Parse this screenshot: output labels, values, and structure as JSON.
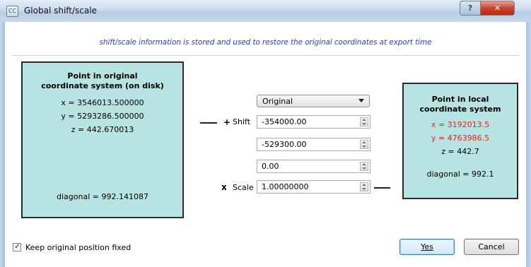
{
  "window": {
    "title": "Global shift/scale",
    "app_icon_text": "CC",
    "help_label": "?",
    "close_label": "✕"
  },
  "info_text": "shift/scale information is stored and used to restore the original coordinates at export time",
  "original_panel": {
    "title_line1": "Point in original",
    "title_line2": "coordinate system (on disk)",
    "x": "x = 3546013.500000",
    "y": "y = 5293286.500000",
    "z": "z = 442.670013",
    "diagonal": "diagonal = 992.141087"
  },
  "local_panel": {
    "title_line1": "Point in local",
    "title_line2": "coordinate system",
    "x": "x = 3192013.5",
    "y": "y = 4763986.5",
    "z": "z = 442.7",
    "diagonal": "diagonal = 992.1"
  },
  "controls": {
    "preset_selected": "Original",
    "plus_sign": "+",
    "shift_label": "Shift",
    "shift_x": "-354000.00",
    "shift_y": "-529300.00",
    "shift_z": "0.00",
    "times_sign": "x",
    "scale_label": "Scale",
    "scale": "1.00000000"
  },
  "footer": {
    "keep_position_label": "Keep original position fixed",
    "keep_position_checked": true,
    "yes_label": "Yes",
    "cancel_label": "Cancel"
  },
  "colors": {
    "panel_bg": "#b7e3e3",
    "info_text": "#2f3fbf",
    "changed_value": "#e8231d"
  }
}
